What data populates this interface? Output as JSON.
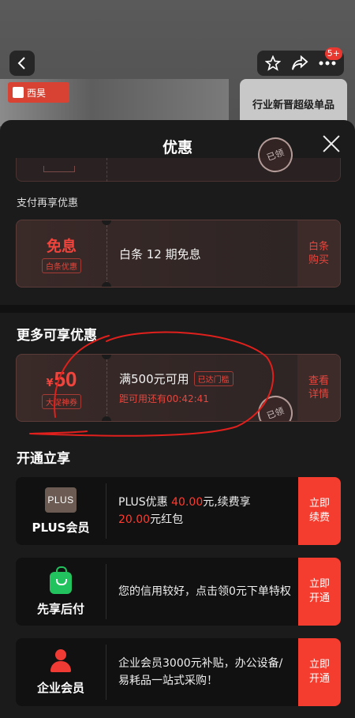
{
  "background_page": {
    "badge_count": "5+",
    "banner_left_logo": "西昊",
    "banner_right_text": "行业新晋超级单品"
  },
  "sheet": {
    "title": "优惠",
    "partial_coupon_stamp": "已领"
  },
  "pay_section": {
    "label": "支付再享优惠",
    "coupon": {
      "title": "免息",
      "tag": "白条优惠",
      "description": "白条 12 期免息",
      "button": "白条购买"
    }
  },
  "more_section": {
    "heading": "更多可享优惠",
    "coupon": {
      "currency": "¥",
      "amount": "50",
      "tag": "大促神券",
      "condition": "满500元可用",
      "reach_tag": "已达门槛",
      "countdown": "距可用还有00:42:41",
      "button": "查看详情",
      "stamp": "已领"
    }
  },
  "membership_section": {
    "heading": "开通立享",
    "items": [
      {
        "icon_text": "PLUS",
        "name": "PLUS会员",
        "desc_parts": [
          "PLUS优惠 ",
          "40.00",
          "元,续费享",
          "20.00",
          "元红包"
        ],
        "button": "立即续费"
      },
      {
        "name": "先享后付",
        "description": "您的信用较好，点击领0元下单特权",
        "button": "立即开通"
      },
      {
        "name": "企业会员",
        "description": "企业会员3000元补贴，办公设备/易耗品一站式采购！",
        "button": "立即开通"
      }
    ]
  },
  "colors": {
    "accent_red": "#f43d2f",
    "sheet_bg": "#1b1b1b",
    "annotation_red": "#e0201c"
  },
  "icons": [
    "back-arrow-icon",
    "star-icon",
    "share-icon",
    "more-icon",
    "close-icon",
    "plus-member-icon",
    "shopping-bag-icon",
    "enterprise-person-icon"
  ]
}
